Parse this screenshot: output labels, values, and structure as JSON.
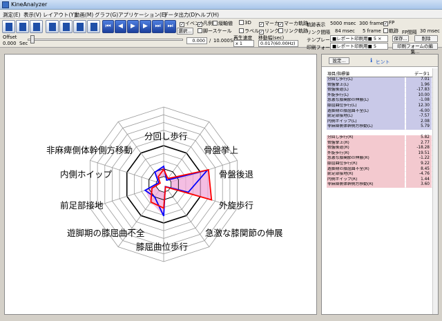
{
  "window": {
    "title": "KineAnalyzer"
  },
  "menu": [
    "測定(E)",
    "表示(V)",
    "レイアウト(Y)",
    "動画(M)",
    "グラフ(G)",
    "アプリケーション(E)",
    "データ出力(D)",
    "ヘルプ(H)"
  ],
  "toolbar": {
    "checkboxes": [
      {
        "label": "イベント",
        "checked": true
      },
      {
        "label": "凡例",
        "checked": true
      },
      {
        "label": "縦軸値",
        "checked": false
      },
      {
        "label": "3D",
        "checked": false
      },
      {
        "label": "マーカ",
        "checked": true
      },
      {
        "label": "マーカ軌跡",
        "checked": true
      },
      {
        "label": "脚ースケール",
        "checked": false
      },
      {
        "label": "ラベル",
        "checked": false
      },
      {
        "label": "リンク",
        "checked": true
      },
      {
        "label": "リンク軌跡",
        "checked": false
      },
      {
        "label": "FP",
        "checked": true
      },
      {
        "label": "軌跡",
        "checked": false
      }
    ],
    "select_button": "選択...",
    "offset_label": "Offset",
    "offset_value": "0.000",
    "offset_unit": "Sec",
    "time_current": "0.000",
    "time_sep": "/",
    "time_total": "10.000",
    "time_unit": "Sec",
    "speed_label": "再生速度",
    "speed_value": "x 1",
    "interval_label": "移動幅(sec)",
    "interval_value": "0.017(60.00Hz)",
    "trail_display_label": "軌跡表示",
    "trail_display_value": "5000 msec",
    "trail_display_frame": "300 frame",
    "link_interval_label": "リンク間隔",
    "link_interval_value": "84 msec",
    "link_interval_frame": "5 frame",
    "fp_interval_label": "FP間隔",
    "fp_interval_value": "30 msec",
    "template_label": "テンプレート",
    "template_value": "■レポート印刷用■ 5 ×",
    "print_form_label": "印刷フォーム",
    "print_form_value": "■レポート印刷用■ 5",
    "save_button": "保存...",
    "delete_button": "削除",
    "edit_print_button": "印刷フォームの編集..."
  },
  "radar": {
    "axes": [
      "分回し歩行",
      "骨盤挙上",
      "骨盤後退",
      "外旋歩行",
      "急激な膝関節の伸展",
      "膝屈曲位歩行",
      "遊脚期の膝屈曲不全",
      "前足部接地",
      "内側ホイップ",
      "非麻痺側体幹側方移動"
    ],
    "rings": 10,
    "max": 30,
    "series": [
      {
        "name": "L",
        "color": "#0000ff",
        "values": [
          7.01,
          1.96,
          17.83,
          10.0,
          1.08,
          12.3,
          6.0,
          7.57,
          2.08,
          5.79
        ]
      },
      {
        "name": "R",
        "color": "#ff0000",
        "values": [
          5.82,
          2.77,
          18.28,
          19.51,
          1.22,
          9.22,
          8.45,
          4.76,
          1.44,
          3.6
        ]
      }
    ],
    "fill_color": "#f0a8d8"
  },
  "right_panel": {
    "settings_button": "設定...",
    "hint_label": "ヒント",
    "col_item": "項目/指標値",
    "col_data": "データ1",
    "rows_left": [
      {
        "name": "分回し歩行(L)",
        "value": "7.01"
      },
      {
        "name": "骨盤挙上(L)",
        "value": "1.96"
      },
      {
        "name": "骨盤後退(L)",
        "value": "-17.83"
      },
      {
        "name": "外旋歩行(L)",
        "value": "10.00"
      },
      {
        "name": "急激な膝関節の伸展(L)",
        "value": "-1.08"
      },
      {
        "name": "膝屈曲位歩行(L)",
        "value": "12.30"
      },
      {
        "name": "遊脚期の膝屈曲不全(L)",
        "value": "-6.00"
      },
      {
        "name": "前足部接地(L)",
        "value": "-7.57"
      },
      {
        "name": "内側ホイップ(L)",
        "value": "2.08"
      },
      {
        "name": "非麻痺側体幹側方移動(L)",
        "value": "5.79"
      }
    ],
    "rows_right": [
      {
        "name": "分回し歩行(R)",
        "value": "5.82"
      },
      {
        "name": "骨盤挙上(R)",
        "value": "2.77"
      },
      {
        "name": "骨盤後退(R)",
        "value": "-18.28"
      },
      {
        "name": "外旋歩行(R)",
        "value": "19.51"
      },
      {
        "name": "急激な膝関節の伸展(R)",
        "value": "-1.22"
      },
      {
        "name": "膝屈曲位歩行(R)",
        "value": "9.22"
      },
      {
        "name": "遊脚期の膝屈曲不全(R)",
        "value": "8.45"
      },
      {
        "name": "前足部接地(R)",
        "value": "-4.76"
      },
      {
        "name": "内側ホイップ(R)",
        "value": "1.44"
      },
      {
        "name": "非麻痺側体幹側方移動(R)",
        "value": "3.60"
      }
    ]
  }
}
